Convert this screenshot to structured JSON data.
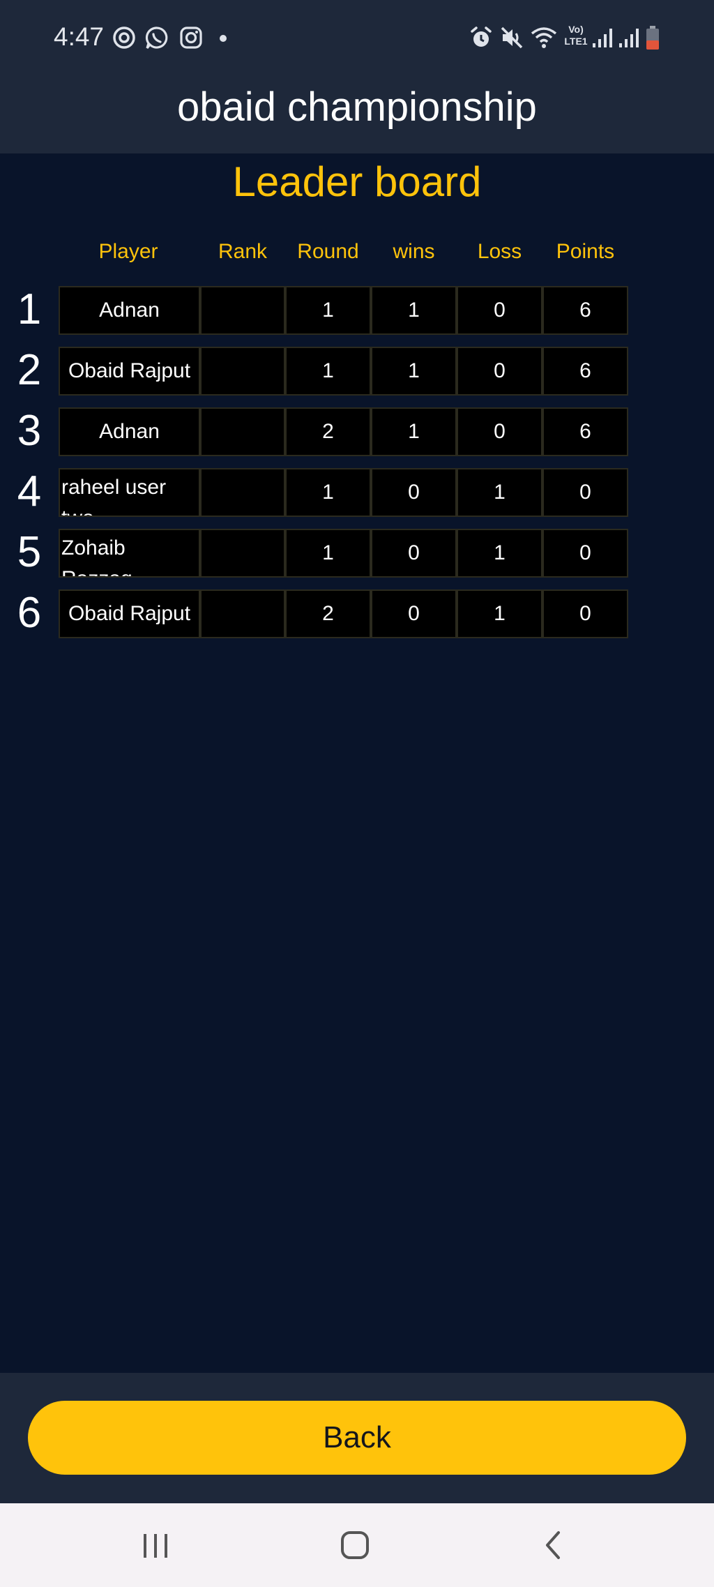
{
  "status_bar": {
    "time": "4:47",
    "left_icons": [
      "sync-icon",
      "whatsapp-icon",
      "instagram-icon",
      "dot-icon"
    ],
    "right_icons": [
      "alarm-icon",
      "mute-icon",
      "wifi-icon",
      "volte-icon",
      "signal-icon",
      "signal-icon",
      "battery-icon"
    ],
    "volte_text_top": "Vo)",
    "volte_text_bottom": "LTE1"
  },
  "app_bar": {
    "title": "obaid championship"
  },
  "leaderboard": {
    "title": "Leader board",
    "columns": [
      "Player",
      "Rank",
      "Round",
      "wins",
      "Loss",
      "Points"
    ],
    "rows": [
      {
        "num": "1",
        "player": "Adnan",
        "rank": "",
        "round": "1",
        "wins": "1",
        "loss": "0",
        "points": "6"
      },
      {
        "num": "2",
        "player": "Obaid Rajput",
        "rank": "",
        "round": "1",
        "wins": "1",
        "loss": "0",
        "points": "6"
      },
      {
        "num": "3",
        "player": "Adnan",
        "rank": "",
        "round": "2",
        "wins": "1",
        "loss": "0",
        "points": "6"
      },
      {
        "num": "4",
        "player": "raheel user two",
        "rank": "",
        "round": "1",
        "wins": "0",
        "loss": "1",
        "points": "0"
      },
      {
        "num": "5",
        "player": "Zohaib Razzaq",
        "rank": "",
        "round": "1",
        "wins": "0",
        "loss": "1",
        "points": "0"
      },
      {
        "num": "6",
        "player": "Obaid Rajput",
        "rank": "",
        "round": "2",
        "wins": "0",
        "loss": "1",
        "points": "0"
      }
    ]
  },
  "bottom": {
    "back_label": "Back"
  },
  "nav_bar": {
    "buttons": [
      "recent-apps-icon",
      "home-icon",
      "back-nav-icon"
    ]
  },
  "colors": {
    "accent": "#ffc30b",
    "background": "#09142a",
    "bar": "#1e283a",
    "cell": "#000000"
  }
}
